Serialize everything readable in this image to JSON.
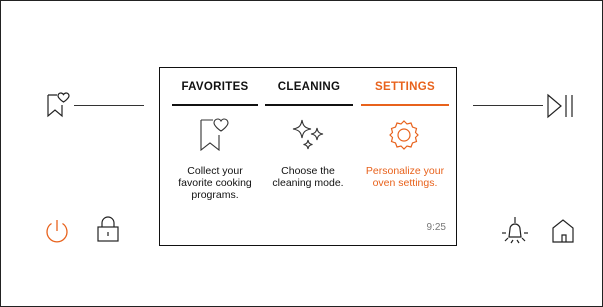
{
  "colors": {
    "accent": "#e8621c",
    "foreground": "#111111",
    "muted": "#777777"
  },
  "left_panel": {
    "favorites_icon": "bookmark-heart-icon"
  },
  "right_panel": {
    "play_pause_icon": "play-pause-icon"
  },
  "bottom_left": {
    "power_icon": "power-icon",
    "lock_icon": "lock-icon"
  },
  "bottom_right": {
    "light_icon": "light-bulb-icon",
    "home_icon": "home-icon"
  },
  "screen": {
    "tabs": [
      {
        "label": "FAVORITES",
        "description": "Collect your favorite cooking programs.",
        "icon": "bookmark-heart-icon",
        "active": false
      },
      {
        "label": "CLEANING",
        "description": "Choose the cleaning mode.",
        "icon": "sparkle-icon",
        "active": false
      },
      {
        "label": "SETTINGS",
        "description": "Personalize your oven settings.",
        "icon": "gear-icon",
        "active": true
      }
    ],
    "time": "9:25"
  }
}
